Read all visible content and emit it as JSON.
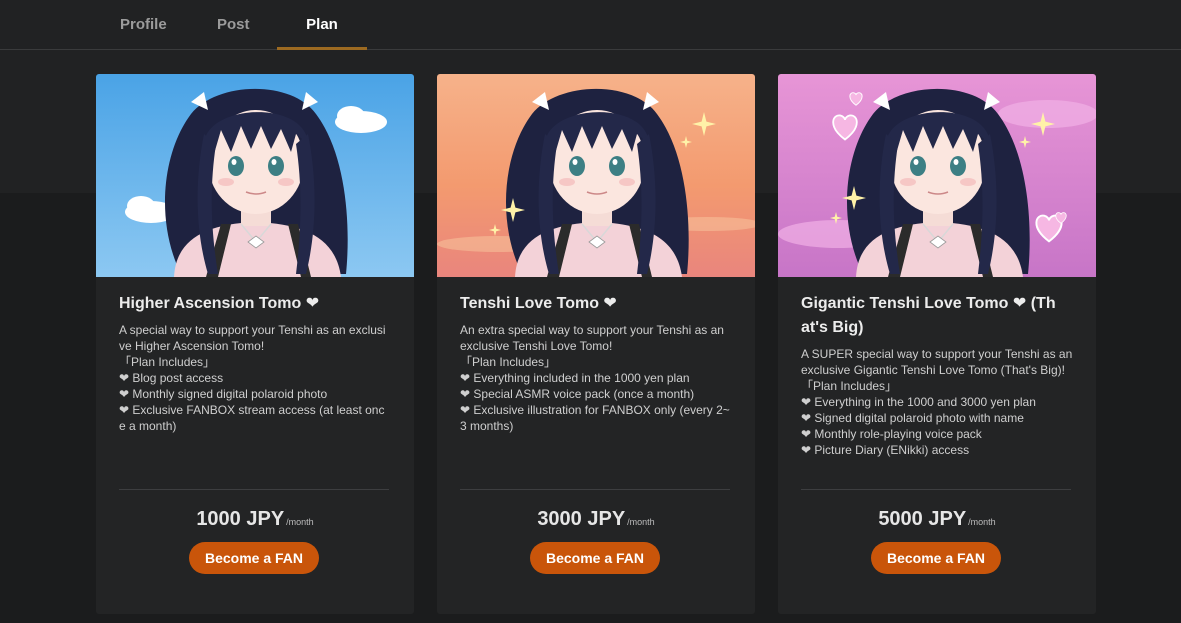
{
  "tabs": [
    {
      "label": "Profile"
    },
    {
      "label": "Post"
    },
    {
      "label": "Plan"
    }
  ],
  "plans": [
    {
      "title": "Higher Ascension Tomo ❤",
      "description": "A special way to support your Tenshi as an exclusive Higher Ascension Tomo!\n「Plan Includes」\n❤ Blog post access\n❤ Monthly signed digital polaroid photo\n❤ Exclusive FANBOX stream access (at least once a month)",
      "price": "1000 JPY",
      "period": "/month",
      "cta": "Become a FAN"
    },
    {
      "title": "Tenshi Love Tomo ❤",
      "description": "An extra special way to support your Tenshi as an exclusive Tenshi Love Tomo!\n「Plan Includes」\n❤ Everything included in the 1000 yen plan\n❤ Special ASMR voice pack (once a month)\n❤ Exclusive illustration for FANBOX only (every 2~3 months)",
      "price": "3000 JPY",
      "period": "/month",
      "cta": "Become a FAN"
    },
    {
      "title": "Gigantic Tenshi Love Tomo ❤ (That's Big)",
      "description": "A SUPER special way to support your Tenshi as an exclusive Gigantic Tenshi Love Tomo (That's Big)!\n「Plan Includes」\n❤ Everything in the 1000 and 3000 yen plan\n❤ Signed digital polaroid photo with name\n❤ Monthly role-playing voice pack\n❤ Picture Diary (ENikki) access",
      "price": "5000 JPY",
      "period": "/month",
      "cta": "Become a FAN"
    }
  ],
  "colors": {
    "accent_button": "#c9550a",
    "tab_underline": "#9c6a21",
    "card_background": "#232425"
  }
}
